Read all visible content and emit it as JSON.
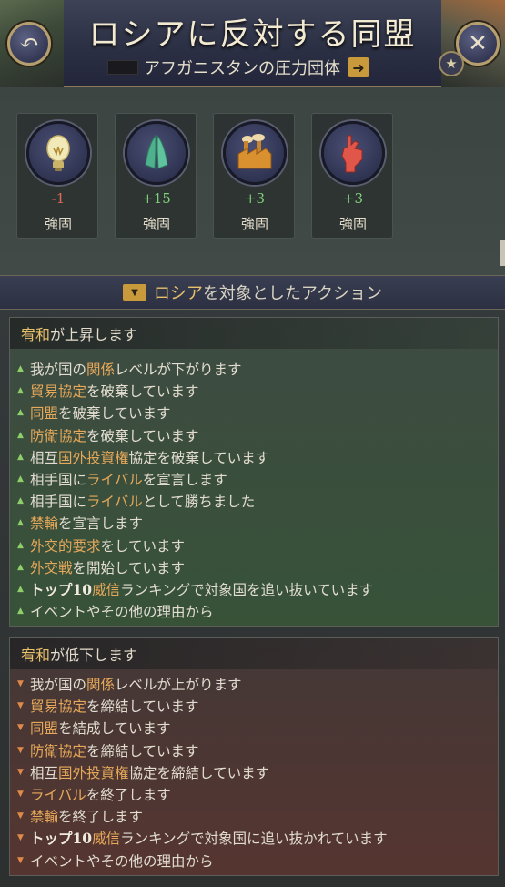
{
  "header": {
    "title": "ロシアに反対する同盟",
    "subtitle": "アフガニスタンの圧力団体",
    "back_icon": "↶",
    "close_icon": "✕",
    "star_icon": "★",
    "arrow_icon": "➜"
  },
  "interest_groups": [
    {
      "icon": "lightbulb-icon",
      "value": "-1",
      "label": "強固",
      "value_color": "#e06a5a"
    },
    {
      "icon": "praying-hands-icon",
      "value": "+15",
      "label": "強固",
      "value_color": "#7fd07a"
    },
    {
      "icon": "factory-icon",
      "value": "+3",
      "label": "強固",
      "value_color": "#7fd07a"
    },
    {
      "icon": "fist-icon",
      "value": "+3",
      "label": "強固",
      "value_color": "#7fd07a"
    }
  ],
  "actions_header": {
    "highlight": "ロシア",
    "rest": "を対象としたアクション"
  },
  "increase": {
    "title_hl": "宥和",
    "title_rest": "が上昇します",
    "items": [
      [
        {
          "t": "我が国の"
        },
        {
          "t": "関係",
          "h": 1
        },
        {
          "t": "レベルが下がります"
        }
      ],
      [
        {
          "t": "貿易協定",
          "h": 1
        },
        {
          "t": "を破棄しています"
        }
      ],
      [
        {
          "t": "同盟",
          "h": 1
        },
        {
          "t": "を破棄しています"
        }
      ],
      [
        {
          "t": "防衛協定",
          "h": 1
        },
        {
          "t": "を破棄しています"
        }
      ],
      [
        {
          "t": "相互"
        },
        {
          "t": "国外投資権",
          "h": 1
        },
        {
          "t": "協定を破棄しています"
        }
      ],
      [
        {
          "t": "相手国に"
        },
        {
          "t": "ライバル",
          "h": 1
        },
        {
          "t": "を宣言します"
        }
      ],
      [
        {
          "t": "相手国に"
        },
        {
          "t": "ライバル",
          "h": 1
        },
        {
          "t": "として勝ちました"
        }
      ],
      [
        {
          "t": "禁輸",
          "h": 1
        },
        {
          "t": "を宣言します"
        }
      ],
      [
        {
          "t": "外交的要求",
          "h": 1
        },
        {
          "t": "をしています"
        }
      ],
      [
        {
          "t": "外交戦",
          "h": 1
        },
        {
          "t": "を開始しています"
        }
      ],
      [
        {
          "t": "トップ10",
          "b": 1
        },
        {
          "t": "威信",
          "h": 1
        },
        {
          "t": "ランキングで対象国を追い抜いています"
        }
      ],
      [
        {
          "t": "イベントやその他の理由から"
        }
      ]
    ]
  },
  "decrease": {
    "title_hl": "宥和",
    "title_rest": "が低下します",
    "items": [
      [
        {
          "t": "我が国の"
        },
        {
          "t": "関係",
          "h": 1
        },
        {
          "t": "レベルが上がります"
        }
      ],
      [
        {
          "t": "貿易協定",
          "h": 1
        },
        {
          "t": "を締結しています"
        }
      ],
      [
        {
          "t": "同盟",
          "h": 1
        },
        {
          "t": "を結成しています"
        }
      ],
      [
        {
          "t": "防衛協定",
          "h": 1
        },
        {
          "t": "を締結しています"
        }
      ],
      [
        {
          "t": "相互"
        },
        {
          "t": "国外投資権",
          "h": 1
        },
        {
          "t": "協定を締結しています"
        }
      ],
      [
        {
          "t": "ライバル",
          "h": 1
        },
        {
          "t": "を終了します"
        }
      ],
      [
        {
          "t": "禁輸",
          "h": 1
        },
        {
          "t": "を終了します"
        }
      ],
      [
        {
          "t": "トップ10",
          "b": 1
        },
        {
          "t": "威信",
          "h": 1
        },
        {
          "t": "ランキングで対象国に追い抜かれています"
        }
      ],
      [
        {
          "t": "イベントやその他の理由から"
        }
      ]
    ]
  }
}
